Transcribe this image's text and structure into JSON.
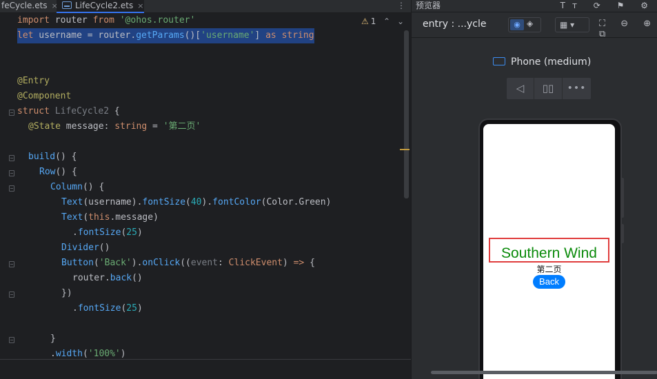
{
  "editor": {
    "tabs": [
      {
        "label": "feCycle.ets",
        "close": "×"
      },
      {
        "label": "LifeCycle2.ets",
        "close": "×"
      }
    ],
    "tab_menu": "⋮",
    "warnings": {
      "icon": "⚠",
      "count": "1"
    },
    "nav_up": "⌃",
    "nav_down": "⌄",
    "code": {
      "l1": {
        "kw": "import",
        "t1": " router ",
        "kw2": "from",
        "sp": " ",
        "s": "'@ohos.router'"
      },
      "l2": {
        "kw": "let",
        "t1": " username = router.",
        "fn": "getParams",
        "t2": "()[",
        "s": "'username'",
        "t3": "] ",
        "kw2": "as",
        "sp": " ",
        "ty": "string"
      },
      "l5": "@Entry",
      "l6": "@Component",
      "l7": {
        "kw": "struct",
        "sp": " ",
        "name": "LifeCycle2",
        "t": " {"
      },
      "l8": {
        "ann": "@State",
        "t1": " message: ",
        "ty": "string",
        "t2": " = ",
        "s": "'第二页'"
      },
      "l10": {
        "fn": "build",
        "t": "() {"
      },
      "l11": {
        "fn": "Row",
        "t": "() {"
      },
      "l12": {
        "fn": "Column",
        "t": "() {"
      },
      "l13": {
        "fn": "Text",
        "t1": "(username).",
        "fn2": "fontSize",
        "t2": "(",
        "n": "40",
        "t3": ").",
        "fn3": "fontColor",
        "t4": "(Color.",
        "p": "Green",
        "t5": ")"
      },
      "l14": {
        "fn": "Text",
        "t1": "(",
        "kw": "this",
        "t2": ".message)"
      },
      "l15": {
        "t1": ".",
        "fn": "fontSize",
        "t2": "(",
        "n": "25",
        "t3": ")"
      },
      "l16": {
        "fn": "Divider",
        "t": "()"
      },
      "l17": {
        "fn": "Button",
        "t1": "(",
        "s": "'Back'",
        "t2": ").",
        "fn2": "onClick",
        "t3": "((",
        "g": "event",
        "t4": ": ",
        "ty": "ClickEvent",
        "t5": ") ",
        "kw": "=>",
        "t6": " {"
      },
      "l18": {
        "t1": "router.",
        "fn": "back",
        "t2": "()"
      },
      "l19": "})",
      "l20": {
        "t1": ".",
        "fn": "fontSize",
        "t2": "(",
        "n": "25",
        "t3": ")"
      },
      "l22": "}",
      "l23": {
        "t1": ".",
        "fn": "width",
        "t2": "(",
        "s": "'100%'",
        "t3": ")"
      }
    }
  },
  "previewer": {
    "title": "预览器",
    "header_icons": "Tт ⟳ ⚑ ⚙",
    "entry_label": "entry : ...ycle",
    "eye_icon": "◉",
    "layers_icon": "◈",
    "grid_icon": "▦ ▾",
    "tool_icons": "⛶ ⊖ ⊕ ⧉",
    "device_name": "Phone (medium)",
    "controls": {
      "back": "◁",
      "rotate": "▯▯",
      "more": "•••"
    },
    "app": {
      "username_text": "Southern Wind",
      "message_text": "第二页",
      "button_label": "Back"
    }
  }
}
